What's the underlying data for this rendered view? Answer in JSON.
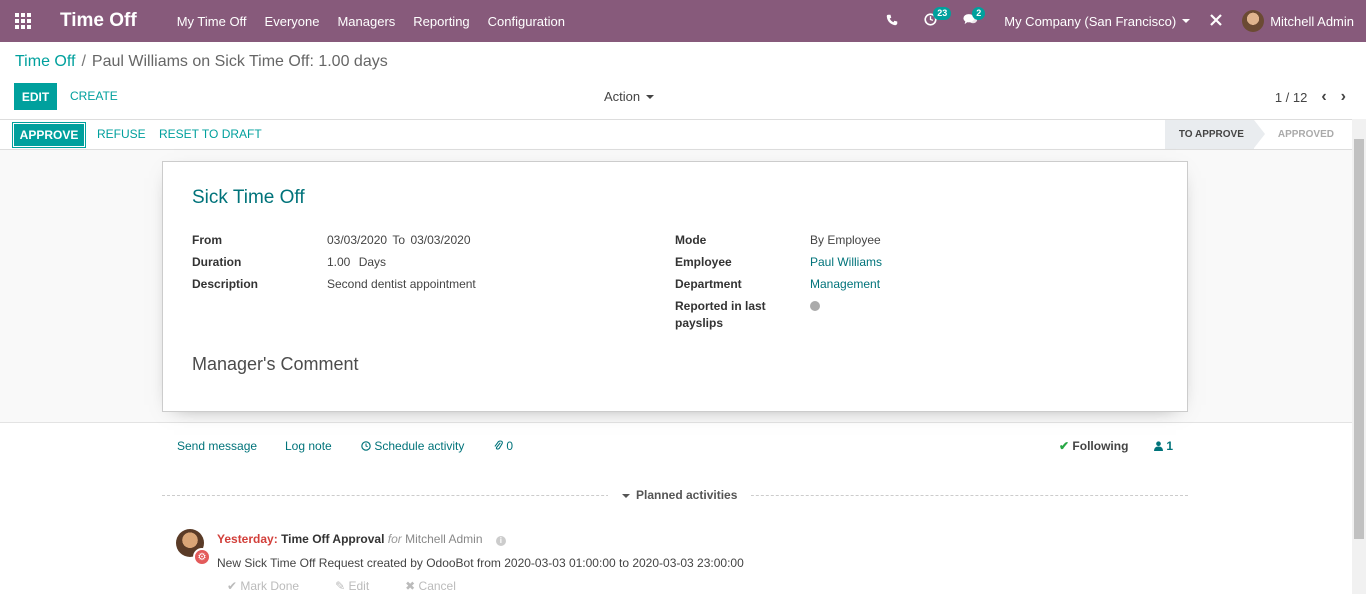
{
  "navbar": {
    "app_title": "Time Off",
    "menu": [
      "My Time Off",
      "Everyone",
      "Managers",
      "Reporting",
      "Configuration"
    ],
    "activity_count": "23",
    "message_count": "2",
    "company": "My Company (San Francisco)",
    "user": "Mitchell Admin"
  },
  "breadcrumb": {
    "parent": "Time Off",
    "current": "Paul Williams on Sick Time Off: 1.00 days"
  },
  "control": {
    "edit": "EDIT",
    "create": "CREATE",
    "action": "Action",
    "pager": "1 / 12"
  },
  "statusbar": {
    "approve": "APPROVE",
    "refuse": "REFUSE",
    "reset": "RESET TO DRAFT",
    "stages": [
      "TO APPROVE",
      "APPROVED"
    ]
  },
  "form": {
    "title": "Sick Time Off",
    "from_label": "From",
    "from_value": "03/03/2020",
    "to_label": "To",
    "to_value": "03/03/2020",
    "duration_label": "Duration",
    "duration_value": "1.00",
    "duration_unit": "Days",
    "description_label": "Description",
    "description_value": "Second dentist appointment",
    "mode_label": "Mode",
    "mode_value": "By Employee",
    "employee_label": "Employee",
    "employee_value": "Paul Williams",
    "department_label": "Department",
    "department_value": "Management",
    "reported_label": "Reported in last payslips",
    "comment_title": "Manager's Comment"
  },
  "chatter": {
    "send_message": "Send message",
    "log_note": "Log note",
    "schedule_activity": "Schedule activity",
    "attachments": "0",
    "following": "Following",
    "followers": "1",
    "planned_activities": "Planned activities",
    "activity": {
      "when": "Yesterday",
      "sep": ":",
      "type": "Time Off Approval",
      "for_word": "for",
      "user": "Mitchell Admin",
      "note": "New Sick Time Off Request created by OdooBot from 2020-03-03 01:00:00 to 2020-03-03 23:00:00",
      "mark_done": "Mark Done",
      "edit": "Edit",
      "cancel": "Cancel"
    }
  },
  "colors": {
    "navbar": "#875a7b",
    "primary": "#00a09d",
    "link": "#00737a"
  }
}
